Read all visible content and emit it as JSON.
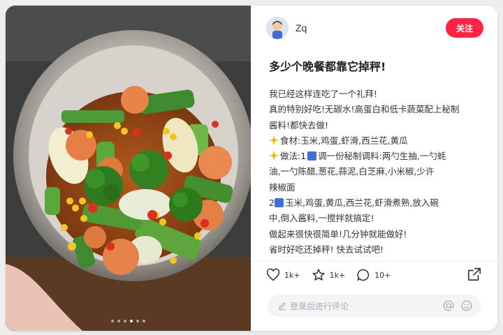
{
  "author": {
    "name": "Zq"
  },
  "follow_label": "关注",
  "post": {
    "title": "多少个晚餐都靠它掉秤!",
    "line1": "我已经这样连吃了一个礼拜!",
    "line2": "真的特别好吃!无碳水!高蛋白和低卡蔬菜配上秘制",
    "line3": "酱料!都快去做!",
    "line4": "食材:玉米,鸡蛋,虾滑,西兰花,黄瓜",
    "line5a": "做法:1",
    "line5b": "调一份秘制调料:两勺生抽,一勺蚝",
    "line6": "油,一勺陈醋,葱花,蒜泥,白芝麻,小米椒,少许",
    "line7": "辣椒面",
    "line8a": "2",
    "line8b": "玉米,鸡蛋,黄瓜,西兰花,虾滑煮熟,放入碗",
    "line9": "中,倒入酱料,一搅拌就搞定!",
    "line10": "做起来很快很简单!几分钟就能做好!",
    "line11": "省时好吃还掉秤! 快去试试吧!"
  },
  "stats": {
    "likes": "1k+",
    "collects": "1k+",
    "comments": "10+"
  },
  "comment_placeholder": "登录后进行评论",
  "carousel": {
    "count": 6,
    "active_index": 3
  },
  "colors": {
    "accent": "#ff2442",
    "number_badge": "#3f6fd8"
  },
  "icons": [
    "heart-icon",
    "star-icon",
    "comment-bubble-icon",
    "share-icon",
    "edit-pencil-icon",
    "at-icon",
    "emoji-icon",
    "sparkle-icon"
  ]
}
